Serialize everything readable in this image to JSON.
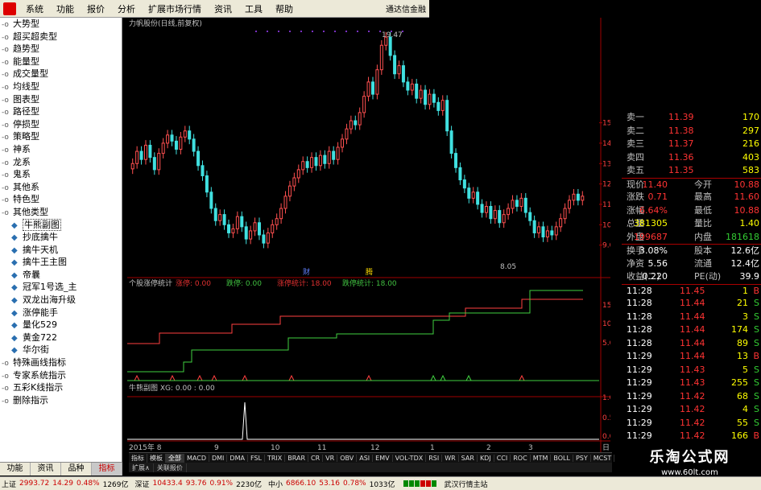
{
  "menubar": {
    "items": [
      "系统",
      "功能",
      "报价",
      "分析",
      "扩展市场行情",
      "资讯",
      "工具",
      "帮助"
    ],
    "brand": "通达信金融"
  },
  "sidebar": {
    "items": [
      {
        "label": "大势型",
        "child": false
      },
      {
        "label": "超买超卖型",
        "child": false
      },
      {
        "label": "趋势型",
        "child": false
      },
      {
        "label": "能量型",
        "child": false
      },
      {
        "label": "成交量型",
        "child": false
      },
      {
        "label": "均线型",
        "child": false
      },
      {
        "label": "图表型",
        "child": false
      },
      {
        "label": "路径型",
        "child": false
      },
      {
        "label": "停损型",
        "child": false
      },
      {
        "label": "策略型",
        "child": false
      },
      {
        "label": "神系",
        "child": false
      },
      {
        "label": "龙系",
        "child": false
      },
      {
        "label": "鬼系",
        "child": false
      },
      {
        "label": "其他系",
        "child": false
      },
      {
        "label": "特色型",
        "child": false
      },
      {
        "label": "其他类型",
        "child": false
      },
      {
        "label": "牛熊副图",
        "child": true,
        "selected": true
      },
      {
        "label": "抄底擒牛",
        "child": true
      },
      {
        "label": "擒牛天机",
        "child": true
      },
      {
        "label": "擒牛王主图",
        "child": true
      },
      {
        "label": "帝曩",
        "child": true
      },
      {
        "label": "冠军1号选_主",
        "child": true
      },
      {
        "label": "双龙出海升级",
        "child": true
      },
      {
        "label": "涨停能手",
        "child": true
      },
      {
        "label": "量化529",
        "child": true
      },
      {
        "label": "黄金722",
        "child": true
      },
      {
        "label": "华尔街",
        "child": true
      },
      {
        "label": "特殊画线指标",
        "child": false
      },
      {
        "label": "专家系统指示",
        "child": false
      },
      {
        "label": "五彩K线指示",
        "child": false
      },
      {
        "label": "删除指示",
        "child": false
      }
    ],
    "tabs": [
      "功能",
      "资讯",
      "品种",
      "指标"
    ],
    "active_tab": "指标"
  },
  "chart": {
    "title": "力帆股份(日线,前复权)",
    "high_label": "19.47",
    "low_label": "8.05",
    "events": [
      "财",
      "腾"
    ],
    "y_ticks": [
      "15.00",
      "14.00",
      "13.00",
      "12.00",
      "11.00",
      "10.00",
      "9.00"
    ],
    "sub1": {
      "name": "个股涨停统计",
      "items": [
        {
          "k": "涨停:",
          "v": "0.00",
          "color": "#e03030"
        },
        {
          "k": "跌停:",
          "v": "0.00",
          "color": "#40c040"
        },
        {
          "k": "涨停统计:",
          "v": "18.00",
          "color": "#e03030"
        },
        {
          "k": "跌停统计:",
          "v": "18.00",
          "color": "#40c040"
        }
      ],
      "y_ticks": [
        "15.00",
        "10.00",
        "5.00"
      ]
    },
    "sub2": {
      "title": "牛熊副图 XG: 0.00 : 0.00",
      "y_ticks": [
        "1.00",
        "0.50",
        "0.00"
      ]
    },
    "x_labels": [
      "2015年 8",
      "9",
      "10",
      "11",
      "12",
      "1",
      "2",
      "3"
    ],
    "x_right": "日"
  },
  "bottom_tabs": {
    "indicators": [
      "指标",
      "模板",
      "全部",
      "MACD",
      "DMI",
      "DMA",
      "FSL",
      "TRIX",
      "BRAR",
      "CR",
      "VR",
      "OBV",
      "ASI",
      "EMV",
      "VOL-TDX",
      "RSI",
      "WR",
      "SAR",
      "KDJ",
      "CCI",
      "ROC",
      "MTM",
      "BOLL",
      "PSY",
      "MCST"
    ],
    "active": "全部",
    "sub": [
      "扩展∧",
      "关联报价"
    ]
  },
  "quote": {
    "colors": {
      "up": "#ff3333",
      "down": "#33cc33",
      "label": "#c0c0c0",
      "vol": "#ffff00",
      "sep": "#a00000"
    },
    "asks": [
      {
        "label": "卖一",
        "price": "11.39",
        "vol": "170"
      },
      {
        "label": "卖二",
        "price": "11.38",
        "vol": "297"
      },
      {
        "label": "卖三",
        "price": "11.37",
        "vol": "216"
      },
      {
        "label": "卖四",
        "price": "11.36",
        "vol": "403"
      },
      {
        "label": "卖五",
        "price": "11.35",
        "vol": "583"
      }
    ],
    "stats": [
      {
        "l1": "现价",
        "v1": "11.40",
        "l2": "今开",
        "v2": "10.88"
      },
      {
        "l1": "涨跌",
        "v1": "0.71",
        "l2": "最高",
        "v2": "11.60"
      },
      {
        "l1": "涨幅",
        "v1": "6.64%",
        "l2": "最低",
        "v2": "10.88"
      },
      {
        "l1": "总量",
        "v1": "381305",
        "l2": "量比",
        "v2": "1.40"
      },
      {
        "l1": "外盘",
        "v1": "199687",
        "l2": "内盘",
        "v2": "181618"
      }
    ],
    "fund": [
      {
        "l1": "换手",
        "v1": "3.08%",
        "l2": "股本",
        "v2": "12.6亿"
      },
      {
        "l1": "净资",
        "v1": "5.56",
        "l2": "流通",
        "v2": "12.4亿"
      },
      {
        "l1": "收益(二)",
        "v1": "0.220",
        "l2": "PE(动)",
        "v2": "39.9"
      }
    ],
    "ticks": [
      {
        "t": "11:28",
        "p": "11.45",
        "v": "1",
        "d": "B"
      },
      {
        "t": "11:28",
        "p": "11.44",
        "v": "21",
        "d": "S"
      },
      {
        "t": "11:28",
        "p": "11.44",
        "v": "3",
        "d": "S"
      },
      {
        "t": "11:28",
        "p": "11.44",
        "v": "174",
        "d": "S"
      },
      {
        "t": "11:28",
        "p": "11.44",
        "v": "89",
        "d": "S"
      },
      {
        "t": "11:29",
        "p": "11.44",
        "v": "13",
        "d": "B"
      },
      {
        "t": "11:29",
        "p": "11.43",
        "v": "5",
        "d": "S"
      },
      {
        "t": "11:29",
        "p": "11.43",
        "v": "255",
        "d": "S"
      },
      {
        "t": "11:29",
        "p": "11.42",
        "v": "68",
        "d": "S"
      },
      {
        "t": "11:29",
        "p": "11.42",
        "v": "4",
        "d": "S"
      },
      {
        "t": "11:29",
        "p": "11.42",
        "v": "55",
        "d": "S"
      },
      {
        "t": "11:29",
        "p": "11.42",
        "v": "166",
        "d": "B"
      }
    ]
  },
  "watermark": {
    "line1": "乐淘公式网",
    "line2": "www.60lt.com"
  },
  "statusbar": {
    "sh_label": "上证",
    "sh_val": "2993.72",
    "sh_chg": "14.29",
    "sh_pct": "0.48%",
    "sh_amt": "1269亿",
    "sz_label": "深证",
    "sz_val": "10433.4",
    "sz_chg": "93.76",
    "sz_pct": "0.91%",
    "sz_amt": "2230亿",
    "zx_label": "中小",
    "zx_val": "6866.10",
    "zx_chg": "53.16",
    "zx_pct": "0.78%",
    "zx_amt": "1033亿",
    "site": "武汉行情主站"
  }
}
